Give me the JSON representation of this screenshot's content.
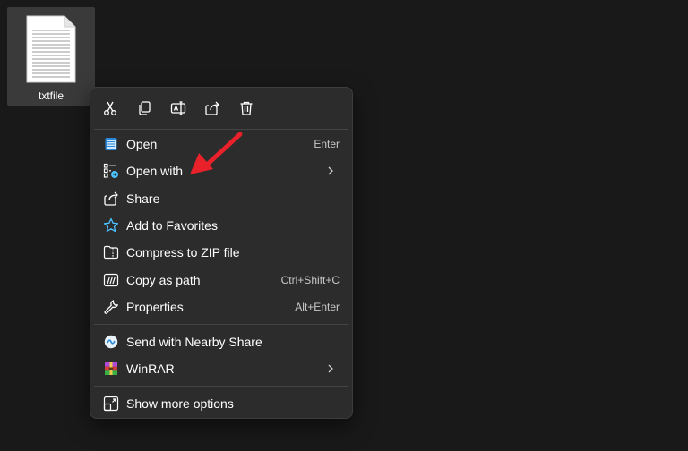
{
  "desktop": {
    "file_label": "txtfile",
    "file_icon": "text-document-icon"
  },
  "toolbar": {
    "buttons": [
      {
        "name": "cut",
        "icon": "scissors-icon"
      },
      {
        "name": "copy",
        "icon": "copy-icon"
      },
      {
        "name": "rename",
        "icon": "rename-icon"
      },
      {
        "name": "share",
        "icon": "share-icon"
      },
      {
        "name": "delete",
        "icon": "trash-icon"
      }
    ]
  },
  "menu": {
    "items": [
      {
        "label": "Open",
        "shortcut": "Enter",
        "icon": "notepad-icon"
      },
      {
        "label": "Open with",
        "shortcut": "",
        "icon": "open-with-icon",
        "submenu": true
      },
      {
        "label": "Share",
        "shortcut": "",
        "icon": "share-icon"
      },
      {
        "label": "Add to Favorites",
        "shortcut": "",
        "icon": "star-icon"
      },
      {
        "label": "Compress to ZIP file",
        "shortcut": "",
        "icon": "zip-folder-icon"
      },
      {
        "label": "Copy as path",
        "shortcut": "Ctrl+Shift+C",
        "icon": "copy-path-icon"
      },
      {
        "label": "Properties",
        "shortcut": "Alt+Enter",
        "icon": "wrench-icon"
      },
      {
        "label": "Send with Nearby Share",
        "shortcut": "",
        "icon": "nearby-share-icon"
      },
      {
        "label": "WinRAR",
        "shortcut": "",
        "icon": "winrar-icon",
        "submenu": true
      },
      {
        "label": "Show more options",
        "shortcut": "",
        "icon": "show-more-options-icon"
      }
    ]
  },
  "colors": {
    "background": "#191919",
    "menu_bg": "#2c2c2c",
    "accent_blue": "#4cc2ff",
    "annotation_arrow": "#e8212b"
  }
}
